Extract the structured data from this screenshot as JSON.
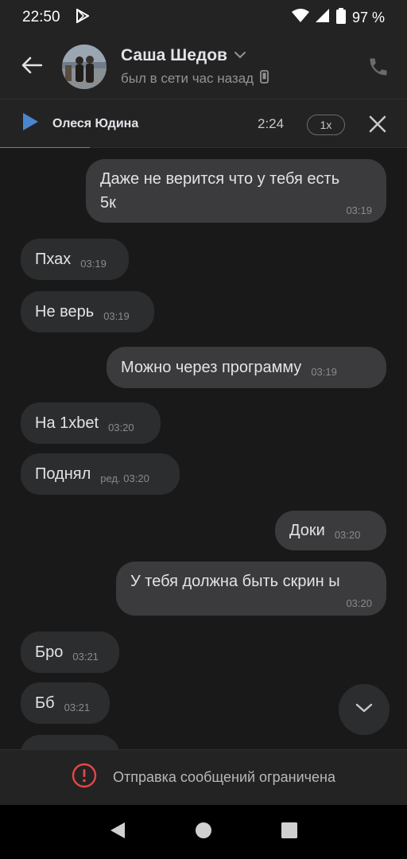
{
  "status_bar": {
    "time": "22:50",
    "battery": "97 %",
    "icons": [
      "play-store-icon",
      "wifi-icon",
      "signal-icon",
      "battery-icon"
    ]
  },
  "header": {
    "name": "Саша Шедов",
    "status": "был в сети час назад",
    "icons": [
      "back-arrow-icon",
      "chevron-down-icon",
      "mobile-icon",
      "phone-icon"
    ]
  },
  "player": {
    "title": "Олеся Юдина",
    "time": "2:24",
    "speed": "1x",
    "progress": 0.22
  },
  "messages": [
    {
      "side": "out",
      "text": "Даже не верится что у тебя есть\n5к",
      "time": "03:19"
    },
    {
      "side": "in",
      "text": "Пхах",
      "time": "03:19"
    },
    {
      "side": "in",
      "text": "Не верь",
      "time": "03:19"
    },
    {
      "side": "out",
      "text": "Можно через программу",
      "time": "03:19"
    },
    {
      "side": "in",
      "text": "На 1xbet",
      "time": "03:20"
    },
    {
      "side": "in",
      "text": "Поднял",
      "time": "ред. 03:20"
    },
    {
      "side": "out",
      "text": "Доки",
      "time": "03:20"
    },
    {
      "side": "out",
      "text": "У тебя должна быть скрин ы",
      "time": "03:20"
    },
    {
      "side": "in",
      "text": "Бро",
      "time": "03:21"
    },
    {
      "side": "in",
      "text": "Бб",
      "time": "03:21"
    }
  ],
  "composer": {
    "restriction_text": "Отправка сообщений ограничена"
  },
  "colors": {
    "accent": "#4986cc",
    "background": "#19191a",
    "bubble_in": "#2c2d2e",
    "bubble_out": "#3b3b3d",
    "error": "#e64646"
  }
}
